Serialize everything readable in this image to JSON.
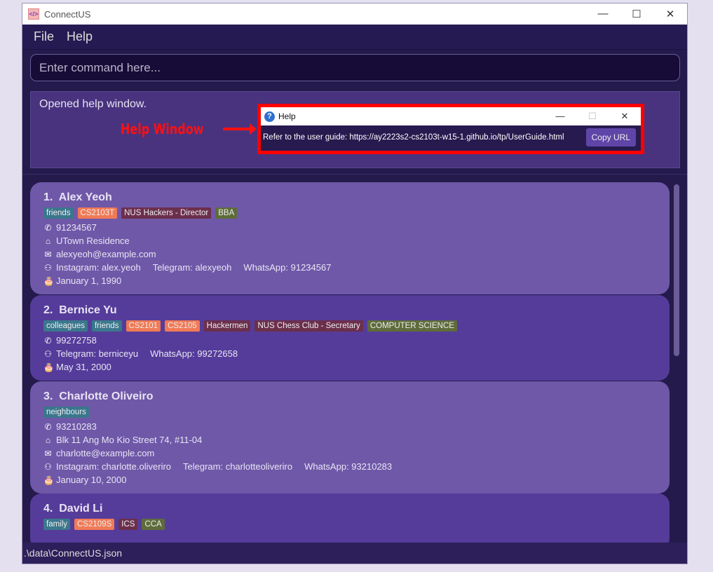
{
  "window": {
    "title": "ConnectUS",
    "minimize": "—",
    "maximize": "☐",
    "close": "✕"
  },
  "menu": [
    "File",
    "Help"
  ],
  "command": {
    "placeholder": "Enter command here...",
    "value": ""
  },
  "result": "Opened help window.",
  "annotation": {
    "label": "Help Window",
    "color": "#ff0000"
  },
  "help": {
    "title": "Help",
    "text": "Refer to the user guide: https://ay2223s2-cs2103t-w15-1.github.io/tp/UserGuide.html",
    "copy": "Copy URL"
  },
  "tag_colors": {
    "teal": "#3a778c",
    "orange": "#f07a56",
    "maroon": "#6b2f4c",
    "olive": "#5e6c3a"
  },
  "persons": [
    {
      "index": "1.",
      "name": "Alex Yeoh",
      "tags": [
        [
          "friends",
          "teal"
        ],
        [
          "CS2103T",
          "orange"
        ],
        [
          "NUS Hackers - Director",
          "maroon"
        ],
        [
          "BBA",
          "olive"
        ]
      ],
      "phone": "91234567",
      "address": "UTown Residence",
      "email": "alexyeoh@example.com",
      "socials": [
        "Instagram: alex.yeoh",
        "Telegram: alexyeoh",
        "WhatsApp: 91234567"
      ],
      "birthday": "January 1, 1990"
    },
    {
      "index": "2.",
      "name": "Bernice Yu",
      "tags": [
        [
          "colleagues",
          "teal"
        ],
        [
          "friends",
          "teal"
        ],
        [
          "CS2101",
          "orange"
        ],
        [
          "CS2105",
          "orange"
        ],
        [
          "Hackermen",
          "maroon"
        ],
        [
          "NUS Chess Club - Secretary",
          "maroon"
        ],
        [
          "COMPUTER SCIENCE",
          "olive"
        ]
      ],
      "phone": "99272758",
      "socials": [
        "Telegram: berniceyu",
        "WhatsApp: 99272658"
      ],
      "birthday": "May 31, 2000"
    },
    {
      "index": "3.",
      "name": "Charlotte Oliveiro",
      "tags": [
        [
          "neighbours",
          "teal"
        ]
      ],
      "phone": "93210283",
      "address": "Blk 11 Ang Mo Kio Street 74, #11-04",
      "email": "charlotte@example.com",
      "socials": [
        "Instagram: charlotte.oliveriro",
        "Telegram: charlotteoliveriro",
        "WhatsApp: 93210283"
      ],
      "birthday": "January 10, 2000"
    },
    {
      "index": "4.",
      "name": "David Li",
      "tags": [
        [
          "family",
          "teal"
        ],
        [
          "CS2109S",
          "orange"
        ],
        [
          "ICS",
          "maroon"
        ],
        [
          "CCA",
          "olive"
        ]
      ]
    }
  ],
  "status": ".\\data\\ConnectUS.json"
}
